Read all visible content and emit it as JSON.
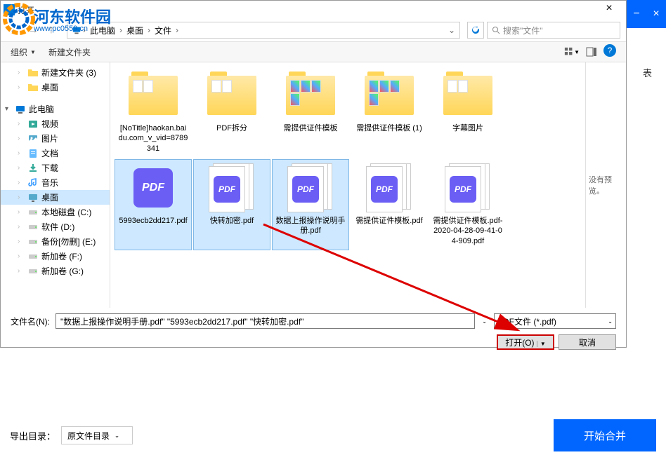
{
  "watermark": {
    "cn": "河东软件园",
    "en": "www.pc0559.cn"
  },
  "dialog": {
    "title": "打开",
    "breadcrumb": [
      "此电脑",
      "桌面",
      "文件"
    ],
    "search_placeholder": "搜索\"文件\"",
    "toolbar": {
      "organize": "组织",
      "new_folder": "新建文件夹"
    },
    "preview_text": "没有预览。",
    "filename_label": "文件名(N):",
    "filename_value": "\"数据上报操作说明手册.pdf\" \"5993ecb2dd217.pdf\" \"快转加密.pdf\"",
    "filetype": "PDF文件 (*.pdf)",
    "open_btn": "打开(O)",
    "cancel_btn": "取消"
  },
  "tree": [
    {
      "label": "新建文件夹 (3)",
      "icon": "folder",
      "indent": 1
    },
    {
      "label": "桌面",
      "icon": "folder",
      "indent": 1
    },
    {
      "label": "",
      "icon": "",
      "indent": 0,
      "blank": true
    },
    {
      "label": "此电脑",
      "icon": "pc",
      "indent": 0,
      "chev": "▾"
    },
    {
      "label": "视频",
      "icon": "video",
      "indent": 1
    },
    {
      "label": "图片",
      "icon": "image",
      "indent": 1
    },
    {
      "label": "文档",
      "icon": "doc",
      "indent": 1
    },
    {
      "label": "下载",
      "icon": "download",
      "indent": 1
    },
    {
      "label": "音乐",
      "icon": "music",
      "indent": 1
    },
    {
      "label": "桌面",
      "icon": "desktop",
      "indent": 1,
      "selected": true
    },
    {
      "label": "本地磁盘 (C:)",
      "icon": "disk",
      "indent": 1
    },
    {
      "label": "软件 (D:)",
      "icon": "disk",
      "indent": 1
    },
    {
      "label": "备份[勿删] (E:)",
      "icon": "disk",
      "indent": 1
    },
    {
      "label": "新加卷 (F:)",
      "icon": "disk",
      "indent": 1
    },
    {
      "label": "新加卷 (G:)",
      "icon": "disk",
      "indent": 1
    }
  ],
  "files": [
    {
      "label": "[NoTitle]haokan.baidu.com_v_vid=8789341",
      "type": "folder"
    },
    {
      "label": "PDF拆分",
      "type": "folder"
    },
    {
      "label": "需提供证件模板",
      "type": "folder-img"
    },
    {
      "label": "需提供证件模板 (1)",
      "type": "folder-img"
    },
    {
      "label": "字幕图片",
      "type": "folder"
    },
    {
      "label": "5993ecb2dd217.pdf",
      "type": "pdf",
      "selected": true
    },
    {
      "label": "快转加密.pdf",
      "type": "pdf-stack",
      "selected": true
    },
    {
      "label": "数据上报操作说明手册.pdf",
      "type": "pdf-stack",
      "selected": true
    },
    {
      "label": "需提供证件模板.pdf",
      "type": "pdf-stack"
    },
    {
      "label": "需提供证件模板.pdf-2020-04-28-09-41-04-909.pdf",
      "type": "pdf-stack"
    }
  ],
  "bg": {
    "tab_label": "表"
  },
  "bottom": {
    "export_label": "导出目录：",
    "export_value": "原文件目录",
    "start_btn": "开始合并"
  }
}
